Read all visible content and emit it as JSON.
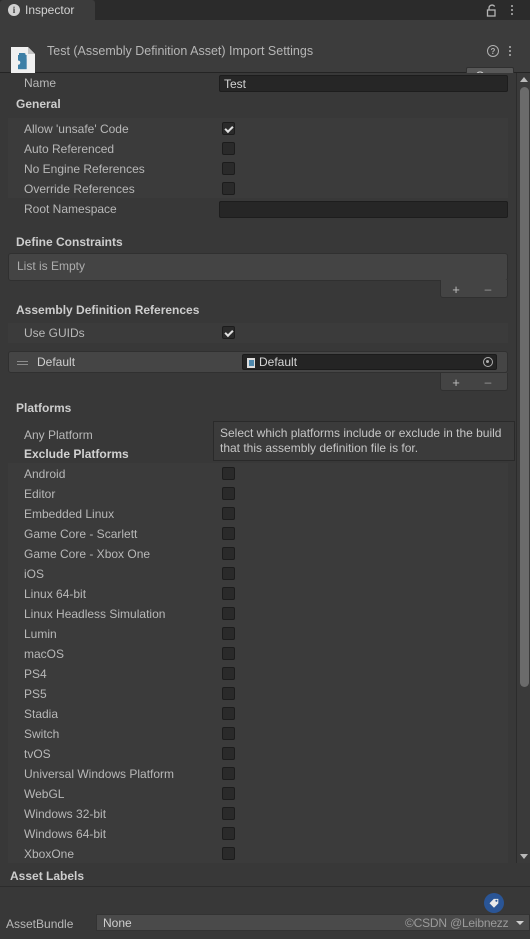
{
  "window": {
    "tab_label": "Inspector",
    "tab_icon": "info-icon",
    "lock_icon": "lock-open-icon",
    "menu_icon": "kebab-menu-icon"
  },
  "asset_header": {
    "title": "Test (Assembly Definition Asset) Import Settings",
    "icon": "assembly-definition-asset-icon",
    "help_icon": "help-icon",
    "menu_icon": "kebab-menu-icon",
    "open_button": "Open"
  },
  "name_row": {
    "label": "Name",
    "value": "Test"
  },
  "general": {
    "header": "General",
    "items": [
      {
        "label": "Allow 'unsafe' Code",
        "checked": true
      },
      {
        "label": "Auto Referenced",
        "checked": false
      },
      {
        "label": "No Engine References",
        "checked": false
      },
      {
        "label": "Override References",
        "checked": false
      }
    ],
    "root_namespace": {
      "label": "Root Namespace",
      "value": ""
    }
  },
  "define_constraints": {
    "header": "Define Constraints",
    "empty_text": "List is Empty",
    "add_label": "+",
    "remove_label": "–"
  },
  "assembly_references": {
    "header": "Assembly Definition References",
    "use_guids": {
      "label": "Use GUIDs",
      "checked": true
    },
    "rows": [
      {
        "name": "Default",
        "object_value": "Default"
      }
    ],
    "add_label": "+",
    "remove_label": "–"
  },
  "platforms": {
    "header": "Platforms",
    "any_platform_label": "Any Platform",
    "exclude_platforms_label": "Exclude Platforms",
    "info_text": "Select which platforms include or exclude in the build that this assembly definition file is for.",
    "items": [
      {
        "label": "Android",
        "checked": false
      },
      {
        "label": "Editor",
        "checked": false
      },
      {
        "label": "Embedded Linux",
        "checked": false
      },
      {
        "label": "Game Core - Scarlett",
        "checked": false
      },
      {
        "label": "Game Core - Xbox One",
        "checked": false
      },
      {
        "label": "iOS",
        "checked": false
      },
      {
        "label": "Linux 64-bit",
        "checked": false
      },
      {
        "label": "Linux Headless Simulation",
        "checked": false
      },
      {
        "label": "Lumin",
        "checked": false
      },
      {
        "label": "macOS",
        "checked": false
      },
      {
        "label": "PS4",
        "checked": false
      },
      {
        "label": "PS5",
        "checked": false
      },
      {
        "label": "Stadia",
        "checked": false
      },
      {
        "label": "Switch",
        "checked": false
      },
      {
        "label": "tvOS",
        "checked": false
      },
      {
        "label": "Universal Windows Platform",
        "checked": false
      },
      {
        "label": "WebGL",
        "checked": false
      },
      {
        "label": "Windows 32-bit",
        "checked": false
      },
      {
        "label": "Windows 64-bit",
        "checked": false
      },
      {
        "label": "XboxOne",
        "checked": false
      }
    ]
  },
  "footer": {
    "asset_labels_header": "Asset Labels",
    "tag_icon": "tag-icon",
    "assetbundle_label": "AssetBundle",
    "assetbundle_value": "None",
    "watermark": "©CSDN @Leibnezz"
  },
  "colors": {
    "background": "#383838",
    "panel": "#3c3c3c",
    "field": "#262626",
    "accent_blue": "#4e87ab",
    "badge_blue": "#2a5596"
  }
}
